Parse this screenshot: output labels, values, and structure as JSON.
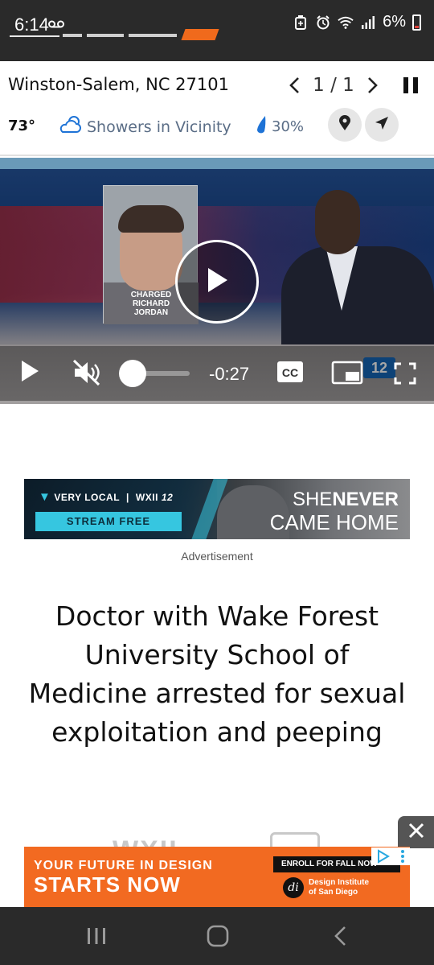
{
  "status_bar": {
    "time": "6:14",
    "voicemail_icon": "voicemail-icon",
    "battery": "6%",
    "icons": [
      "battery-saver-icon",
      "alarm-icon",
      "wifi-icon",
      "signal-icon"
    ]
  },
  "weather": {
    "location": "Winston-Salem, NC 27101",
    "page_counter": "1 / 1",
    "temperature": "73°",
    "condition": "Showers in Vicinity",
    "precip_chance": "30%",
    "colors": {
      "condition_text": "#5a6d86",
      "cloud_icon": "#1e73d6",
      "drop_icon": "#1e73d6"
    }
  },
  "video": {
    "mugshot_caption": [
      "CHARGED",
      "RICHARD",
      "JORDAN"
    ],
    "time_remaining": "-0:27",
    "cc_label": "CC",
    "station_badge": "12",
    "playback_position": 0.0
  },
  "ad_top": {
    "brand": "VERY LOCAL",
    "network": "WXII",
    "network_num": "12",
    "cta": "STREAM FREE",
    "title_line1_a": "SHE",
    "title_line1_b": "NEVER",
    "title_line2": "CAME HOME",
    "label": "Advertisement",
    "colors": {
      "accent": "#36c6e0"
    }
  },
  "article": {
    "headline": "Doctor with Wake Forest University School of Medicine arrested for sexual exploitation and peeping"
  },
  "ad_bottom": {
    "line1": "YOUR FUTURE IN DESIGN",
    "line2": "STARTS NOW",
    "enroll": "ENROLL FOR FALL NOW",
    "school_line1": "Design Institute",
    "school_line2": "of San Diego",
    "badge_letter": "di",
    "colors": {
      "background": "#f26a21"
    }
  }
}
